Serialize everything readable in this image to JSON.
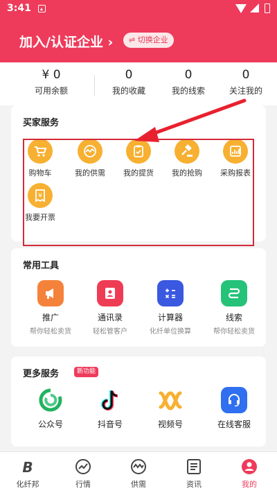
{
  "status_bar": {
    "time": "3:41"
  },
  "header": {
    "title": "加入/认证企业 ›",
    "switch_label": "⇌ 切换企业"
  },
  "stats": [
    {
      "value": "¥ 0",
      "label": "可用余额"
    },
    {
      "value": "0",
      "label": "我的收藏"
    },
    {
      "value": "0",
      "label": "我的线索"
    },
    {
      "value": "0",
      "label": "关注我的"
    }
  ],
  "buyer_services": {
    "title": "买家服务",
    "items": [
      {
        "label": "购物车",
        "icon": "cart-icon"
      },
      {
        "label": "我的供需",
        "icon": "trend-icon"
      },
      {
        "label": "我的提货",
        "icon": "clipboard-icon"
      },
      {
        "label": "我的抢购",
        "icon": "gavel-icon"
      },
      {
        "label": "采购报表",
        "icon": "report-icon"
      },
      {
        "label": "我要开票",
        "icon": "invoice-icon"
      }
    ]
  },
  "tools": {
    "title": "常用工具",
    "items": [
      {
        "label": "推广",
        "sub": "帮你轻松卖货",
        "icon": "megaphone-icon",
        "color": "#f5823a"
      },
      {
        "label": "通讯录",
        "sub": "轻松管客户",
        "icon": "contacts-icon",
        "color": "#ef3c55"
      },
      {
        "label": "计算器",
        "sub": "化纤单位换算",
        "icon": "calculator-icon",
        "color": "#3a58e0"
      },
      {
        "label": "线索",
        "sub": "帮你轻松卖货",
        "icon": "route-icon",
        "color": "#25c27a"
      }
    ]
  },
  "more_services": {
    "title": "更多服务",
    "badge": "新功能",
    "items": [
      {
        "label": "公众号",
        "icon": "wechat-public-icon"
      },
      {
        "label": "抖音号",
        "icon": "tiktok-icon"
      },
      {
        "label": "视频号",
        "icon": "channels-icon"
      },
      {
        "label": "在线客服",
        "icon": "headset-icon"
      }
    ]
  },
  "tabbar": [
    {
      "label": "化纤邦",
      "icon": "brand-icon"
    },
    {
      "label": "行情",
      "icon": "market-icon"
    },
    {
      "label": "供需",
      "icon": "supply-icon"
    },
    {
      "label": "资讯",
      "icon": "news-icon"
    },
    {
      "label": "我的",
      "icon": "profile-icon",
      "active": true
    }
  ],
  "colors": {
    "brand": "#ee3b5b",
    "service_icon": "#f7b031"
  }
}
